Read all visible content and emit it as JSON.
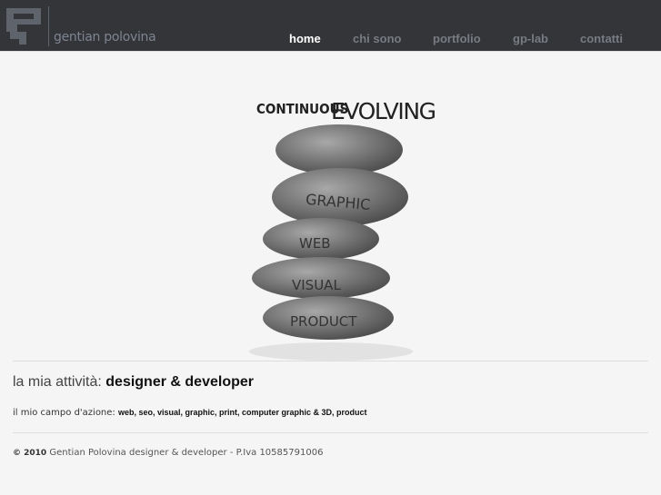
{
  "header": {
    "brand": "gentian polovina",
    "nav": [
      {
        "label": "home",
        "active": true
      },
      {
        "label": "chi sono"
      },
      {
        "label": "portfolio"
      },
      {
        "label": "gp-lab"
      },
      {
        "label": "contatti"
      }
    ]
  },
  "hero": {
    "title_small": "CONTINUOUS",
    "title_big": "EVOLVING",
    "stones": [
      "GRAPHIC",
      "WEB",
      "VISUAL",
      "PRODUCT"
    ]
  },
  "activity": {
    "label": "la mia attività:",
    "value": "designer & developer"
  },
  "field": {
    "label": "il mio campo d'azione:",
    "items": "web, seo, visual, graphic, print, computer graphic & 3D, product"
  },
  "footer": {
    "copyright": "© 2010",
    "text": "Gentian Polovina designer & developer - P.Iva 10585791006"
  }
}
